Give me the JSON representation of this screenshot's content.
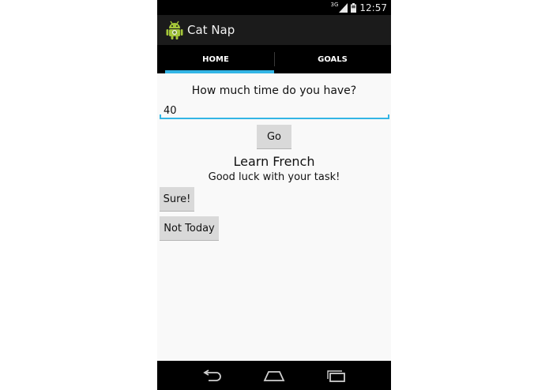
{
  "status_bar": {
    "network": "3G",
    "time": "12:57"
  },
  "action_bar": {
    "app_title": "Cat Nap",
    "icon": "android-robot-icon"
  },
  "tabs": [
    {
      "label": "HOME",
      "active": true
    },
    {
      "label": "GOALS",
      "active": false
    }
  ],
  "home": {
    "prompt": "How much time do you have?",
    "time_input_value": "40",
    "go_label": "Go",
    "task_title": "Learn French",
    "task_message": "Good luck with your task!",
    "sure_label": "Sure!",
    "not_today_label": "Not Today"
  },
  "nav_bar": {
    "icons": [
      "back-icon",
      "home-icon",
      "recent-apps-icon"
    ]
  },
  "colors": {
    "accent": "#33b5e5",
    "action_bar": "#1b1b1b",
    "background": "#f9f9f9",
    "button": "#d9d9d9"
  }
}
